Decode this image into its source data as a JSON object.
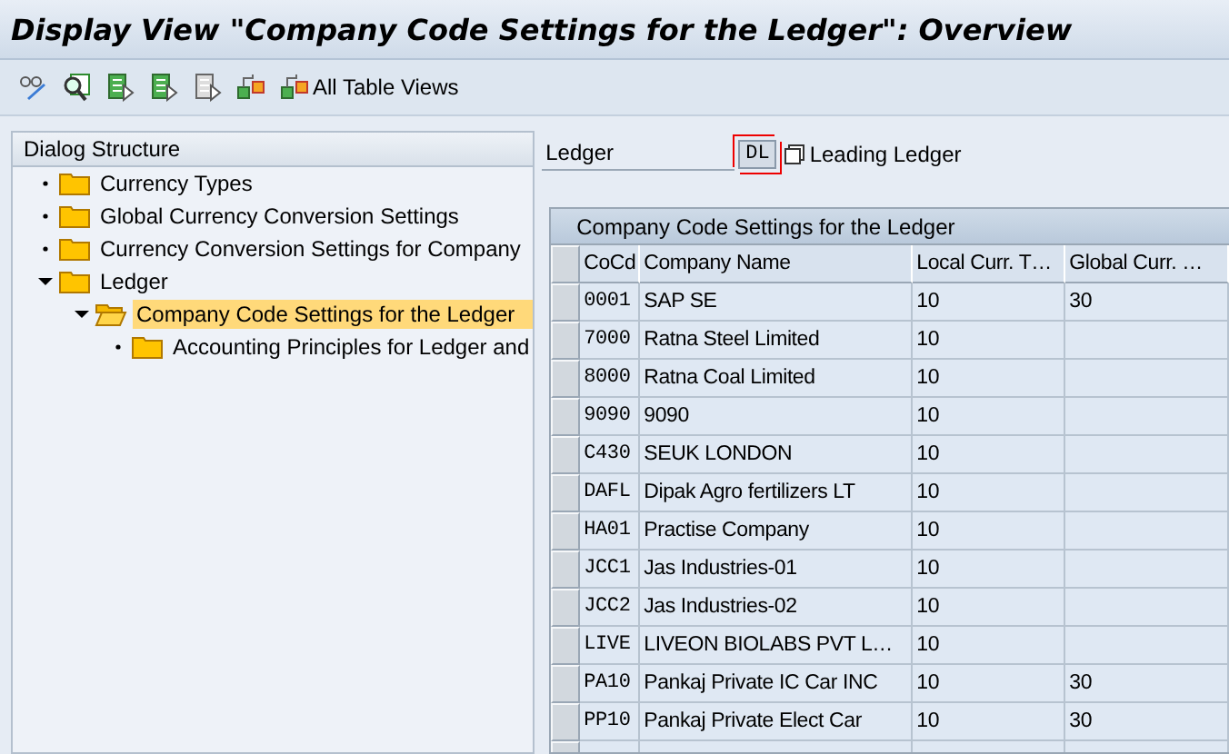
{
  "window": {
    "title": "Display View \"Company Code Settings for the Ledger\": Overview"
  },
  "toolbar": {
    "buttons": [
      {
        "kind": "glasses"
      },
      {
        "kind": "find"
      },
      {
        "kind": "doc-green"
      },
      {
        "kind": "doc-green"
      },
      {
        "kind": "doc-grey"
      },
      {
        "kind": "hierarchy"
      },
      {
        "kind": "hierarchy",
        "label": "All Table Views"
      }
    ]
  },
  "dialog_structure": {
    "title": "Dialog Structure",
    "tree": [
      {
        "label": "Currency Types",
        "expanded": false,
        "selected": false
      },
      {
        "label": "Global Currency Conversion Settings",
        "expanded": false,
        "selected": false
      },
      {
        "label": "Currency Conversion Settings for Company",
        "expanded": false,
        "selected": false
      },
      {
        "label": "Ledger",
        "expanded": true,
        "selected": false,
        "children": [
          {
            "label": "Company Code Settings for the Ledger",
            "expanded": true,
            "selected": true,
            "children": [
              {
                "label": "Accounting Principles for Ledger and",
                "expanded": false,
                "selected": false
              }
            ]
          }
        ]
      }
    ]
  },
  "ledger_field": {
    "label": "Ledger",
    "value": "DL",
    "focused": true,
    "description": "Leading Ledger"
  },
  "table": {
    "title": "Company Code Settings for the Ledger",
    "columns": [
      "CoCd",
      "Company Name",
      "Local Curr. T…",
      "Global Curr. …"
    ],
    "rows": [
      [
        "0001",
        "SAP SE",
        "10",
        "30"
      ],
      [
        "7000",
        "Ratna Steel Limited",
        "10",
        ""
      ],
      [
        "8000",
        "Ratna Coal Limited",
        "10",
        ""
      ],
      [
        "9090",
        "9090",
        "10",
        ""
      ],
      [
        "C430",
        "SEUK LONDON",
        "10",
        ""
      ],
      [
        "DAFL",
        "Dipak Agro fertilizers LT",
        "10",
        ""
      ],
      [
        "HA01",
        "Practise Company",
        "10",
        ""
      ],
      [
        "JCC1",
        "Jas Industries-01",
        "10",
        ""
      ],
      [
        "JCC2",
        "Jas Industries-02",
        "10",
        ""
      ],
      [
        "LIVE",
        "LIVEON BIOLABS PVT L…",
        "10",
        ""
      ],
      [
        "PA10",
        "Pankaj Private IC Car INC",
        "10",
        "30"
      ],
      [
        "PP10",
        "Pankaj Private Elect Car",
        "10",
        "30"
      ]
    ]
  }
}
